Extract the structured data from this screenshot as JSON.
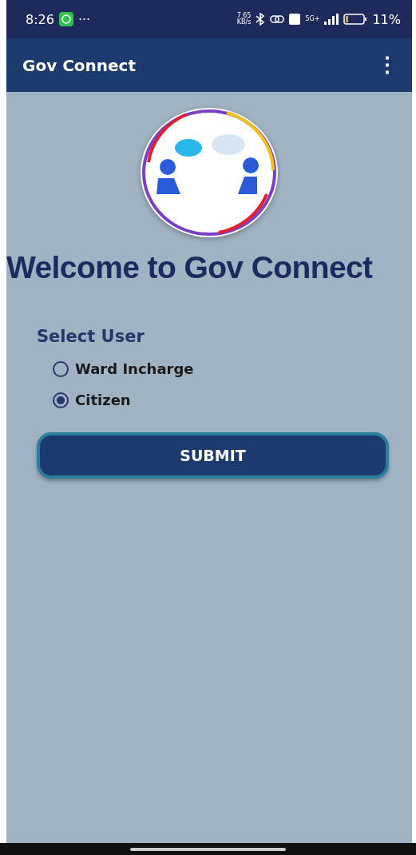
{
  "status_bar": {
    "time": "8:26",
    "more": "···",
    "speed_value": "7.65",
    "speed_unit": "KB/s",
    "network": "5G+",
    "battery": "11%"
  },
  "app_bar": {
    "title": "Gov Connect",
    "menu": "⋮"
  },
  "heading": "Welcome to Gov Connect",
  "select_user": {
    "label": "Select User",
    "options": [
      {
        "label": "Ward Incharge",
        "selected": false
      },
      {
        "label": "Citizen",
        "selected": true
      }
    ]
  },
  "submit": "SUBMIT"
}
